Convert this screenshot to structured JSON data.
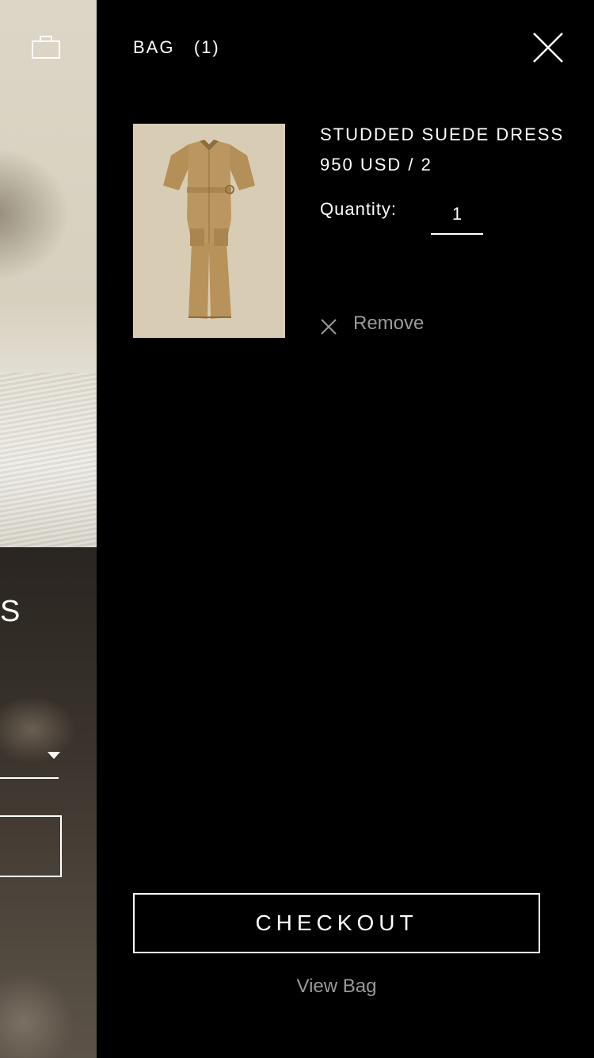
{
  "background_page": {
    "partial_heading": "S"
  },
  "bag": {
    "title": "BAG",
    "count": "(1)"
  },
  "item": {
    "name": "STUDDED SUEDE DRESS",
    "price": "950 USD / 2",
    "quantity_label": "Quantity:",
    "quantity_value": "1",
    "remove_label": "Remove"
  },
  "actions": {
    "checkout_label": "CHECKOUT",
    "view_bag_label": "View Bag"
  },
  "icons": {
    "close": "close-icon",
    "remove": "close-icon",
    "bag": "bag-icon"
  },
  "colors": {
    "drawer_bg": "#000000",
    "text": "#ffffff",
    "muted_text": "#9a9a9a",
    "product_bg": "#d8cdb4",
    "garment": "#b8955f"
  }
}
